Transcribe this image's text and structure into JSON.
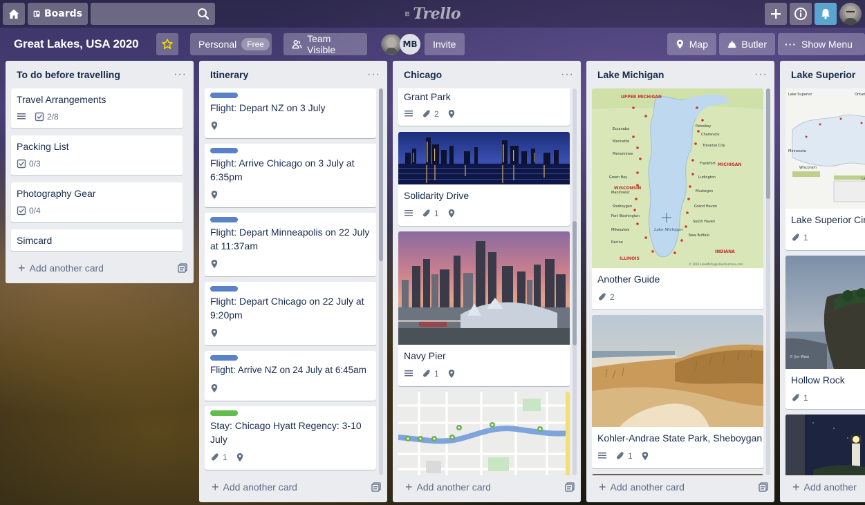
{
  "topbar": {
    "boards_label": "Boards",
    "logo_text": "Trello"
  },
  "board": {
    "title": "Great Lakes, USA 2020",
    "personal_label": "Personal",
    "free_badge": "Free",
    "visibility_label": "Team Visible",
    "member_initials": "MB",
    "invite_label": "Invite",
    "map_label": "Map",
    "butler_label": "Butler",
    "menu_label": "Show Menu"
  },
  "colors": {
    "label_blue": "#5a82c7",
    "label_green": "#61bd4f",
    "list_bg": "#ebecf0",
    "notification": "#5ba4cf"
  },
  "lists": [
    {
      "title": "To do before travelling",
      "add_label": "Add another card",
      "cards": [
        {
          "title": "Travel Arrangements",
          "checklist": "2/8"
        },
        {
          "title": "Packing List",
          "checklist": "0/3"
        },
        {
          "title": "Photography Gear",
          "checklist": "0/4"
        },
        {
          "title": "Simcard"
        }
      ]
    },
    {
      "title": "Itinerary",
      "add_label": "Add another card",
      "cards": [
        {
          "title": "Flight: Depart NZ on 3 July"
        },
        {
          "title": "Flight: Arrive Chicago on 3 July at 6:35pm"
        },
        {
          "title": "Flight: Depart Minneapolis on 22 July at 11:37am"
        },
        {
          "title": "Flight: Depart Chicago on 22 July at 9:20pm"
        },
        {
          "title": "Flight: Arrive NZ on 24 July at 6:45am"
        },
        {
          "title": "Stay: Chicago Hyatt Regency: 3-10 July",
          "attachments": "1"
        }
      ]
    },
    {
      "title": "Chicago",
      "add_label": "Add another card",
      "cards": [
        {
          "title": "Grant Park",
          "attachments": "2"
        },
        {
          "title": "Solidarity Drive",
          "attachments": "1"
        },
        {
          "title": "Navy Pier",
          "attachments": "1"
        }
      ]
    },
    {
      "title": "Lake Michigan",
      "add_label": "Add another card",
      "cards": [
        {
          "title": "Another Guide",
          "attachments": "2"
        },
        {
          "title": "Kohler-Andrae State Park, Sheboygan",
          "attachments": "1"
        }
      ],
      "map_labels": {
        "upper": "UPPER MICHIGAN",
        "wisconsin": "WISCONSIN",
        "michigan": "MICHIGAN",
        "illinois": "ILLINOIS",
        "indiana": "INDIANA",
        "lake": "Lake Michigan",
        "copyright": "© 2019 LakeMichiganDestinations.com"
      }
    },
    {
      "title": "Lake Superior",
      "add_label": "Add another",
      "cards": [
        {
          "title": "Lake Superior Cir",
          "attachments": "1"
        },
        {
          "title": "Hollow Rock",
          "attachments": "1"
        }
      ]
    }
  ]
}
